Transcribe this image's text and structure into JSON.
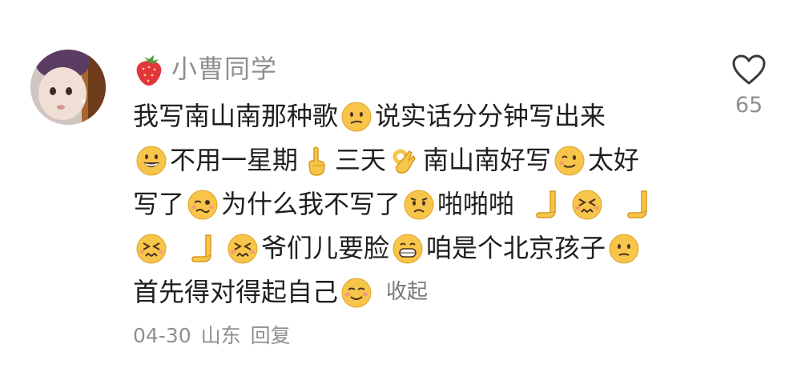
{
  "comment": {
    "username": "小曹同学",
    "badge_icon": "strawberry-icon",
    "like_icon": "heart-outline-icon",
    "like_count": "65",
    "lines": [
      [
        {
          "t": "text",
          "v": "我写南山南那种歌"
        },
        {
          "t": "emoji",
          "v": "confused"
        },
        {
          "t": "text",
          "v": "说实话分分钟写出来"
        }
      ],
      [
        {
          "t": "emoji",
          "v": "grin"
        },
        {
          "t": "text",
          "v": "不用一星期"
        },
        {
          "t": "emoji",
          "v": "finger-up"
        },
        {
          "t": "text",
          "v": "三天"
        },
        {
          "t": "emoji",
          "v": "ok-hand"
        },
        {
          "t": "text",
          "v": "南山南好写"
        },
        {
          "t": "emoji",
          "v": "wink"
        },
        {
          "t": "text",
          "v": "太好"
        }
      ],
      [
        {
          "t": "text",
          "v": "写了"
        },
        {
          "t": "emoji",
          "v": "woozy"
        },
        {
          "t": "text",
          "v": "为什么我不写了"
        },
        {
          "t": "emoji",
          "v": "worried"
        },
        {
          "t": "text",
          "v": "啪啪啪"
        },
        {
          "t": "space"
        },
        {
          "t": "emoji",
          "v": "clap-hand"
        },
        {
          "t": "emoji",
          "v": "dizzy"
        },
        {
          "t": "space"
        },
        {
          "t": "emoji",
          "v": "clap-hand"
        }
      ],
      [
        {
          "t": "emoji",
          "v": "dizzy"
        },
        {
          "t": "space"
        },
        {
          "t": "emoji",
          "v": "clap-hand"
        },
        {
          "t": "emoji",
          "v": "dizzy"
        },
        {
          "t": "text",
          "v": "爷们儿要脸"
        },
        {
          "t": "emoji",
          "v": "grimace"
        },
        {
          "t": "text",
          "v": "咱是个北京孩子"
        },
        {
          "t": "emoji",
          "v": "slight-frown"
        }
      ],
      [
        {
          "t": "text",
          "v": "首先得对得起自己"
        },
        {
          "t": "emoji",
          "v": "smile-blush"
        },
        {
          "t": "collapse",
          "v": "收起"
        }
      ]
    ],
    "meta": {
      "date": "04-30",
      "location": "山东",
      "reply_label": "回复"
    }
  }
}
